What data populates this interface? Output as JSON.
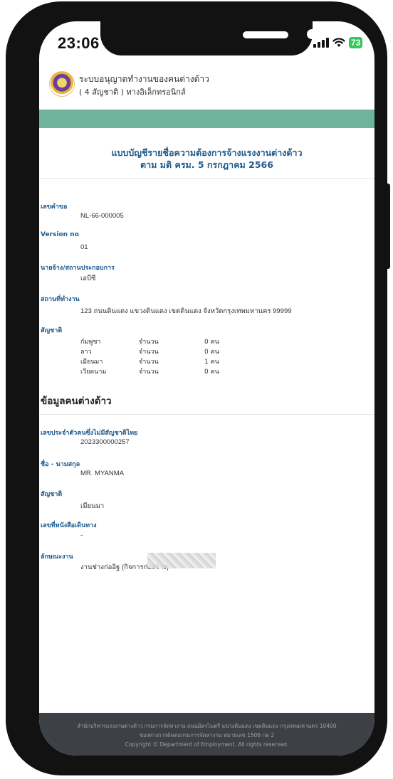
{
  "status_bar": {
    "time": "23:06",
    "battery": "73"
  },
  "agency": {
    "line1": "ระบบอนุญาตทำงานของคนต่างด้าว",
    "line2": "( 4 สัญชาติ ) ทางอิเล็กทรอนิกส์"
  },
  "doc_title": {
    "line1": "แบบบัญชีรายชื่อความต้องการจ้างแรงงานต่างด้าว",
    "line2": "ตาม มติ ครม. 5 กรกฎาคม 2566"
  },
  "fields": {
    "request_no_label": "เลขคำขอ",
    "request_no": "NL-66-000005",
    "version_label": "Version no",
    "version": "01",
    "employer_label": "นายจ้าง/สถานประกอบการ",
    "employer": "เอบีซี",
    "workplace_label": "สถานที่ทำงาน",
    "workplace": "123 ถนนดินแดง แขวงดินแดง เขตดินแดง จังหวัดกรุงเทพมหานคร 99999",
    "nationality_label": "สัญชาติ"
  },
  "nationalities": [
    {
      "name": "กัมพูชา",
      "count_label": "จำนวน",
      "count": "0 คน"
    },
    {
      "name": "ลาว",
      "count_label": "จำนวน",
      "count": "0 คน"
    },
    {
      "name": "เมียนมา",
      "count_label": "จำนวน",
      "count": "1 คน"
    },
    {
      "name": "เวียดนาม",
      "count_label": "จำนวน",
      "count": "0 คน"
    }
  ],
  "worker": {
    "section_title": "ข้อมูลคนต่างด้าว",
    "id_label": "เลขประจำตัวคนซึ่งไม่มีสัญชาติไทย",
    "id": "2023300000257",
    "name_label": "ชื่อ - นามสกุล",
    "name": "MR. MYANMA",
    "nationality_label": "สัญชาติ",
    "nationality": "เมียนมา",
    "passport_label": "เลขที่หนังสือเดินทาง",
    "passport": "-",
    "job_label": "ลักษณะงาน",
    "job": "งานช่างก่ออิฐ (กิจการก่อสร้าง)"
  },
  "footer": {
    "line1": "สำนักบริหารแรงงานต่างด้าว กรมการจัดหางาน ถนนมิตรไมตรี แขวงดินแดง เขตดินแดง กรุงเทพมหานคร 10400",
    "line2": "ช่องทางการติดต่อกรมการจัดหางาน หมายเลข 1506 กด 2",
    "line3": "Copyright © Department of Employment. All rights reserved."
  }
}
